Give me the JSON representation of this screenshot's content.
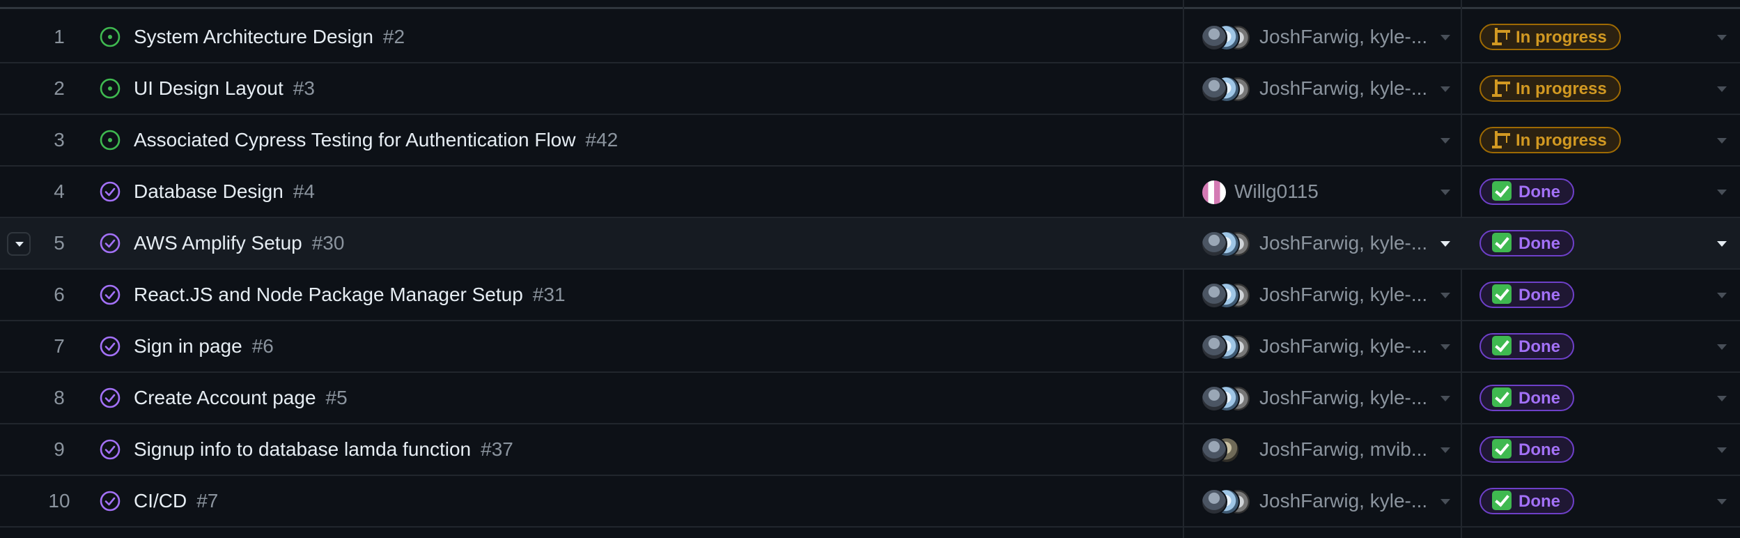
{
  "colors": {
    "background": "#0d1117",
    "open_icon": "#3fb950",
    "closed_icon": "#a371f7",
    "in_progress": "#d29922",
    "done": "#a371f7"
  },
  "rows": [
    {
      "num": "1",
      "title": "System Architecture Design",
      "issue": "#2",
      "state": "open-issue-icon",
      "assignees": "JoshFarwig, kyle-...",
      "avatar_style": "group",
      "status": "In progress",
      "status_emoji": "construction-crane-icon"
    },
    {
      "num": "2",
      "title": "UI Design Layout",
      "issue": "#3",
      "state": "open-issue-icon",
      "assignees": "JoshFarwig, kyle-...",
      "avatar_style": "group",
      "status": "In progress",
      "status_emoji": "construction-crane-icon"
    },
    {
      "num": "3",
      "title": "Associated Cypress Testing for Authentication Flow",
      "issue": "#42",
      "state": "open-issue-icon",
      "assignees": "",
      "avatar_style": "none",
      "status": "In progress",
      "status_emoji": "construction-crane-icon"
    },
    {
      "num": "4",
      "title": "Database Design",
      "issue": "#4",
      "state": "closed-issue-icon",
      "assignees": "Willg0115",
      "avatar_style": "single",
      "status": "Done",
      "status_emoji": "check-mark-icon"
    },
    {
      "num": "5",
      "title": "AWS Amplify Setup",
      "issue": "#30",
      "state": "closed-issue-icon",
      "assignees": "JoshFarwig, kyle-...",
      "avatar_style": "group",
      "status": "Done",
      "status_emoji": "check-mark-icon"
    },
    {
      "num": "6",
      "title": "React.JS and Node Package Manager Setup",
      "issue": "#31",
      "state": "closed-issue-icon",
      "assignees": "JoshFarwig, kyle-...",
      "avatar_style": "group",
      "status": "Done",
      "status_emoji": "check-mark-icon"
    },
    {
      "num": "7",
      "title": "Sign in page",
      "issue": "#6",
      "state": "closed-issue-icon",
      "assignees": "JoshFarwig, kyle-...",
      "avatar_style": "group",
      "status": "Done",
      "status_emoji": "check-mark-icon"
    },
    {
      "num": "8",
      "title": "Create Account page",
      "issue": "#5",
      "state": "closed-issue-icon",
      "assignees": "JoshFarwig, kyle-...",
      "avatar_style": "group",
      "status": "Done",
      "status_emoji": "check-mark-icon"
    },
    {
      "num": "9",
      "title": "Signup info to database lamda function",
      "issue": "#37",
      "state": "closed-issue-icon",
      "assignees": "JoshFarwig, mvib...",
      "avatar_style": "pair",
      "status": "Done",
      "status_emoji": "check-mark-icon"
    },
    {
      "num": "10",
      "title": "CI/CD",
      "issue": "#7",
      "state": "closed-issue-icon",
      "assignees": "JoshFarwig, kyle-...",
      "avatar_style": "group",
      "status": "Done",
      "status_emoji": "check-mark-icon"
    }
  ]
}
